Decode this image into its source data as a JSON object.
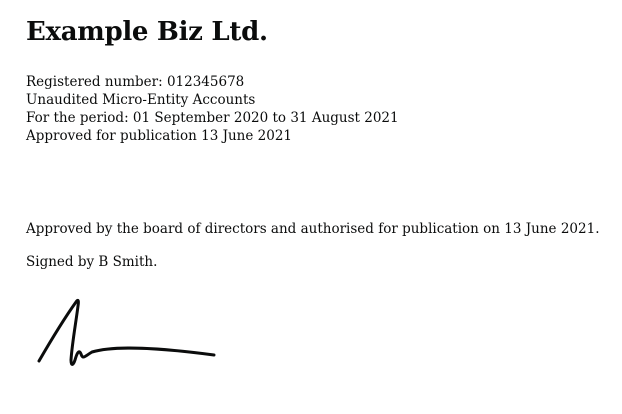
{
  "company": {
    "name": "Example Biz Ltd."
  },
  "details": {
    "registered_number": "Registered number: 012345678",
    "accounts_type": "Unaudited Micro-Entity Accounts",
    "period": "For the period: 01 September 2020 to 31 August 2021",
    "approved": "Approved for publication 13 June 2021"
  },
  "statement": {
    "approval_text": "Approved by the board of directors and authorised for publication on 13 June 2021.",
    "signed_by": "Signed by B Smith."
  },
  "signature": {
    "signatory": "B Smith",
    "ink_color": "#0b0c0c"
  }
}
